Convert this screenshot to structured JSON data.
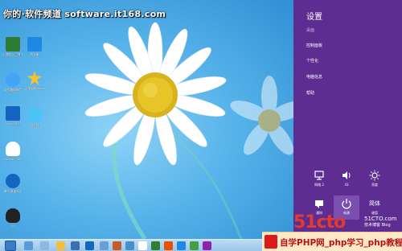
{
  "watermark": {
    "text": "你的·软件频道 software.it168.com"
  },
  "desktop_icons": [
    {
      "label": "计算机及工具下载",
      "color": "#2e7d32"
    },
    {
      "label": "有到家",
      "color": "#1e88e5"
    },
    {
      "label": "收件箱和软件",
      "color": "#42a5f5"
    },
    {
      "label": "此电脑和Mesa",
      "color": "#fbc02d"
    },
    {
      "label": "Word 2013",
      "color": "#1565c0"
    },
    {
      "label": "回收站",
      "color": "#4fc3f7"
    },
    {
      "label": "Foxmail7000",
      "color": "#ffffff"
    },
    {
      "label": "腾讯 桌面助手",
      "color": "#1565c0"
    },
    {
      "label": "QQ",
      "color": "#222222"
    }
  ],
  "charms": {
    "title": "设置",
    "section": "桌面",
    "items": [
      "控制面板",
      "个性化",
      "电脑信息",
      "帮助"
    ],
    "tiles": [
      {
        "label": "网络 2",
        "icon": "network-icon"
      },
      {
        "label": "43",
        "icon": "volume-icon"
      },
      {
        "label": "亮度",
        "icon": "brightness-icon"
      },
      {
        "label": "通知",
        "icon": "notifications-icon"
      },
      {
        "label": "电源",
        "icon": "power-icon"
      },
      {
        "label": "键盘",
        "icon": "keyboard-icon"
      }
    ],
    "keyboard_extra": "简体",
    "accent": "#5d2d91"
  },
  "brand": {
    "logo": "51cto",
    "com": "51CTO.com",
    "sub": "技术博客 Blog"
  },
  "banner": {
    "text": "自学PHP网_php学习_php教程"
  },
  "taskbar": {
    "apps": [
      "start",
      "explorer",
      "ie",
      "folder",
      "media",
      "word",
      "app",
      "app",
      "app",
      "app",
      "app",
      "app",
      "app",
      "app",
      "app"
    ]
  }
}
